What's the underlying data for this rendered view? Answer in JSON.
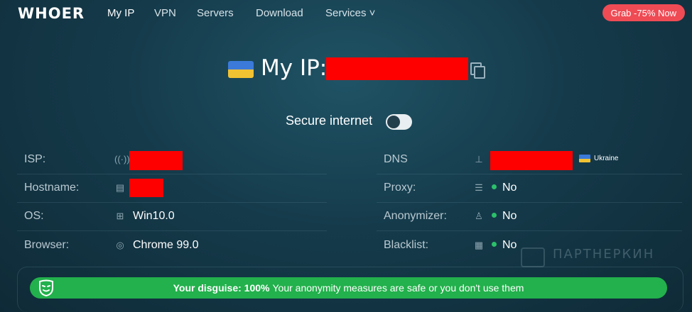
{
  "brand": "WHOER",
  "nav": {
    "items": [
      {
        "label": "My IP",
        "active": true
      },
      {
        "label": "VPN"
      },
      {
        "label": "Servers"
      },
      {
        "label": "Download"
      },
      {
        "label": "Services ˅"
      }
    ],
    "promo": "Grab -75% Now"
  },
  "hero": {
    "title": "My IP:",
    "flag": "ukraine-flag",
    "copy_icon": "copy-icon"
  },
  "secure": {
    "label": "Secure internet",
    "enabled": false
  },
  "left_rows": [
    {
      "label": "ISP:",
      "icon": "signal-icon",
      "value": "",
      "redacted": true
    },
    {
      "label": "Hostname:",
      "icon": "server-icon",
      "value": "",
      "redacted": true
    },
    {
      "label": "OS:",
      "icon": "windows-icon",
      "value": "Win10.0"
    },
    {
      "label": "Browser:",
      "icon": "chrome-icon",
      "value": "Chrome 99.0"
    }
  ],
  "right_rows": [
    {
      "label": "DNS",
      "icon": "network-icon",
      "value": "",
      "redacted": true,
      "country": "Ukraine"
    },
    {
      "label": "Proxy:",
      "icon": "database-icon",
      "value": "No"
    },
    {
      "label": "Anonymizer:",
      "icon": "user-icon",
      "value": "No"
    },
    {
      "label": "Blacklist:",
      "icon": "list-icon",
      "value": "No"
    }
  ],
  "watermark": "ПАРТНЕРКИН",
  "disguise": {
    "label": "Your disguise: 100%",
    "message": "Your anonymity measures are safe or you don't use them",
    "icon": "mask-icon"
  },
  "colors": {
    "background": "#153b4b",
    "promo": "#ef4b55",
    "success": "#22b14c",
    "redaction": "#ff0000"
  }
}
